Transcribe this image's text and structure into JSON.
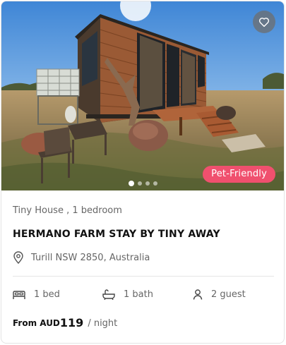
{
  "listing": {
    "badge": "Pet-Friendly",
    "property_type": "Tiny House , 1 bedroom",
    "title": "HERMANO FARM STAY BY TINY AWAY",
    "location": "Turill NSW 2850, Australia",
    "amenities": {
      "beds": "1 bed",
      "baths": "1 bath",
      "guests": "2 guest"
    },
    "price": {
      "prefix": "From AUD",
      "amount": "119",
      "unit": "/ night"
    },
    "carousel": {
      "total_images": 4,
      "active_index": 0
    }
  },
  "icons": {
    "favorite": "heart-icon",
    "location": "map-pin-icon",
    "bed": "bed-icon",
    "bath": "bathtub-icon",
    "guest": "person-icon"
  },
  "colors": {
    "badge_bg": "#f0506e",
    "text_muted": "#666666",
    "text_primary": "#111111"
  }
}
